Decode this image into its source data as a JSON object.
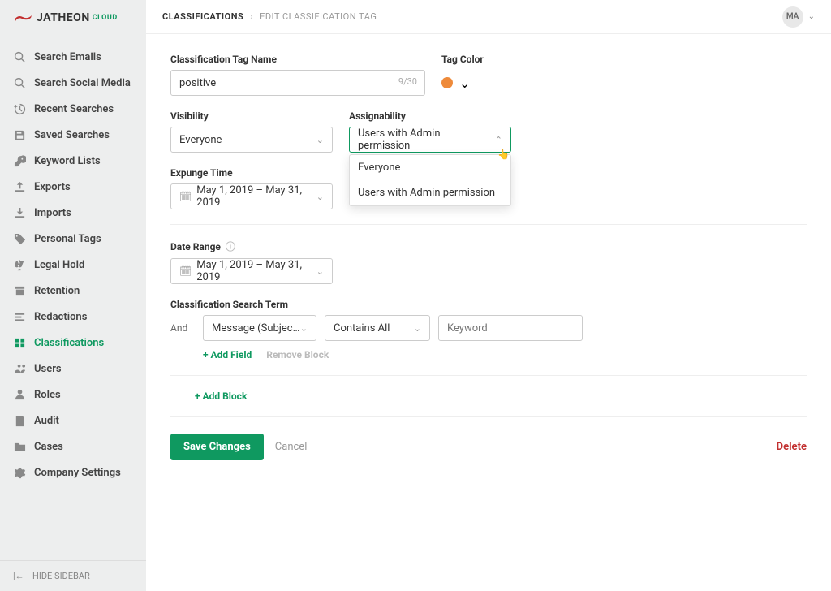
{
  "brand": {
    "name": "JATHEON",
    "suffix": "CLOUD"
  },
  "sidebar": {
    "items": [
      {
        "label": "Search Emails"
      },
      {
        "label": "Search Social Media"
      },
      {
        "label": "Recent Searches"
      },
      {
        "label": "Saved Searches"
      },
      {
        "label": "Keyword Lists"
      },
      {
        "label": "Exports"
      },
      {
        "label": "Imports"
      },
      {
        "label": "Personal Tags"
      },
      {
        "label": "Legal Hold"
      },
      {
        "label": "Retention"
      },
      {
        "label": "Redactions"
      },
      {
        "label": "Classifications"
      },
      {
        "label": "Users"
      },
      {
        "label": "Roles"
      },
      {
        "label": "Audit"
      },
      {
        "label": "Cases"
      },
      {
        "label": "Company Settings"
      }
    ],
    "footer": "HIDE SIDEBAR"
  },
  "breadcrumb": {
    "root": "CLASSIFICATIONS",
    "leaf": "EDIT CLASSIFICATION TAG"
  },
  "user": {
    "initials": "MA"
  },
  "form": {
    "tagName": {
      "label": "Classification Tag Name",
      "value": "positive",
      "counter": "9/30"
    },
    "tagColor": {
      "label": "Tag Color",
      "hex": "#ee8a3a"
    },
    "visibility": {
      "label": "Visibility",
      "value": "Everyone"
    },
    "assignability": {
      "label": "Assignability",
      "value": "Users with Admin permission",
      "options": [
        "Everyone",
        "Users with Admin permission"
      ]
    },
    "expunge": {
      "label": "Expunge Time",
      "value": "May 1, 2019 – May 31, 2019"
    },
    "dateRange": {
      "label": "Date Range",
      "value": "May 1, 2019 – May 31, 2019"
    },
    "searchTerm": {
      "label": "Classification Search Term",
      "operator": "And",
      "field": "Message (Subject, Bod...",
      "condition": "Contains All",
      "keywordPlaceholder": "Keyword",
      "addField": "+ Add Field",
      "removeBlock": "Remove Block",
      "addBlock": "+ Add Block"
    },
    "actions": {
      "save": "Save Changes",
      "cancel": "Cancel",
      "delete": "Delete"
    }
  }
}
